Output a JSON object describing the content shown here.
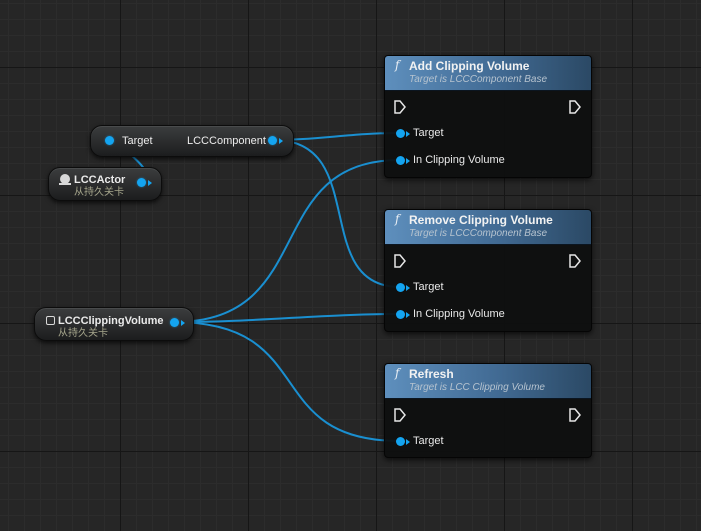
{
  "canvas": {
    "background": "#262626",
    "wire_color": "#1a8fd0",
    "pin_color": "#14a4f0"
  },
  "get_component_node": {
    "left_pin_label": "Target",
    "right_pin_label": "LCCComponent"
  },
  "lcc_actor_node": {
    "title": "LCCActor",
    "subtitle": "从持久关卡",
    "icon": "actor-icon"
  },
  "clipping_volume_node": {
    "title": "LCCClippingVolume",
    "subtitle": "从持久关卡",
    "icon": "volume-icon"
  },
  "function_nodes": [
    {
      "title": "Add Clipping Volume",
      "subtitle": "Target is LCCComponent Base",
      "icon": "f",
      "pins": [
        "Target",
        "In Clipping Volume"
      ]
    },
    {
      "title": "Remove Clipping Volume",
      "subtitle": "Target is LCCComponent Base",
      "icon": "f",
      "pins": [
        "Target",
        "In Clipping Volume"
      ]
    },
    {
      "title": "Refresh",
      "subtitle": "Target is LCC Clipping Volume",
      "icon": "f",
      "pins": [
        "Target"
      ]
    }
  ]
}
